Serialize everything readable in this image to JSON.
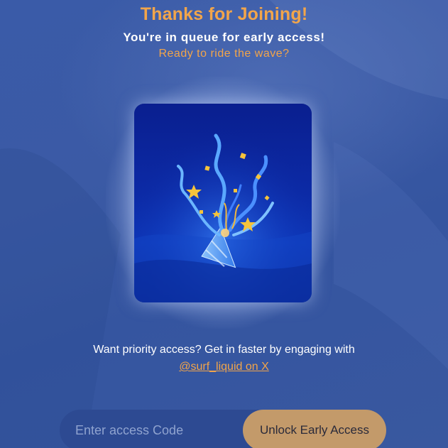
{
  "header": {
    "title": "Thanks for Joining!",
    "subtitle": "You're in queue for early access!",
    "tagline": "Ready to ride the wave?"
  },
  "illustration": {
    "icon": "party-popper-icon"
  },
  "priority": {
    "text": "Want priority access? Get in faster by engaging with",
    "link_label": "@surf_liquid on X"
  },
  "access": {
    "input_value": "",
    "input_placeholder": "Enter access Code",
    "button_label": "Unlock Early Access"
  },
  "colors": {
    "accent": "#f2a54a",
    "background": "#3a5aa3",
    "button": "#c39a6a"
  }
}
